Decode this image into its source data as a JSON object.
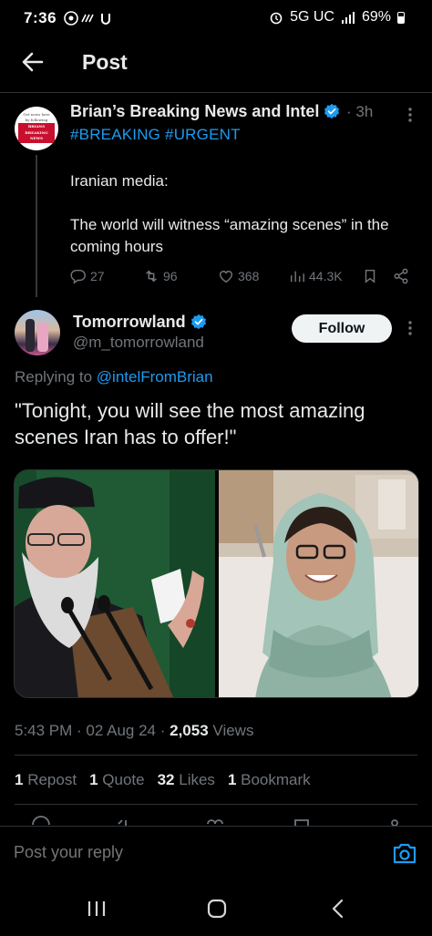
{
  "status_bar": {
    "time": "7:36",
    "network": "5G UC",
    "battery": "69%"
  },
  "header": {
    "title": "Post"
  },
  "original_tweet": {
    "avatar_text": [
      "Get news here",
      "by following",
      "BRIANS",
      "BREAKING",
      "NEWS"
    ],
    "author": "Brian’s Breaking News and Intel",
    "time": "· 3h",
    "hashtags": "#BREAKING #URGENT",
    "body_lines": [
      "Iranian media:",
      "The world will witness “amazing scenes” in the coming hours"
    ],
    "replies": "27",
    "reposts": "96",
    "likes": "368",
    "views": "44.3K"
  },
  "reply_tweet": {
    "author": "Tomorrowland",
    "handle": "@m_tomorrowland",
    "follow_label": "Follow",
    "replying_prefix": "Replying to",
    "replying_to": "@intelFromBrian",
    "body": "\"Tonight, you will see the most amazing scenes Iran has to offer!\"",
    "timestamp": "5:43 PM · 02 Aug 24 ·",
    "views_count": "2,053",
    "views_label": "Views",
    "stats": [
      {
        "count": "1",
        "label": "Repost"
      },
      {
        "count": "1",
        "label": "Quote"
      },
      {
        "count": "32",
        "label": "Likes"
      },
      {
        "count": "1",
        "label": "Bookmark"
      }
    ]
  },
  "reply_bar": {
    "placeholder": "Post your reply"
  },
  "colors": {
    "accent": "#1d9bf0",
    "background": "#000000",
    "muted": "#71767b",
    "text": "#e7e9ea"
  }
}
